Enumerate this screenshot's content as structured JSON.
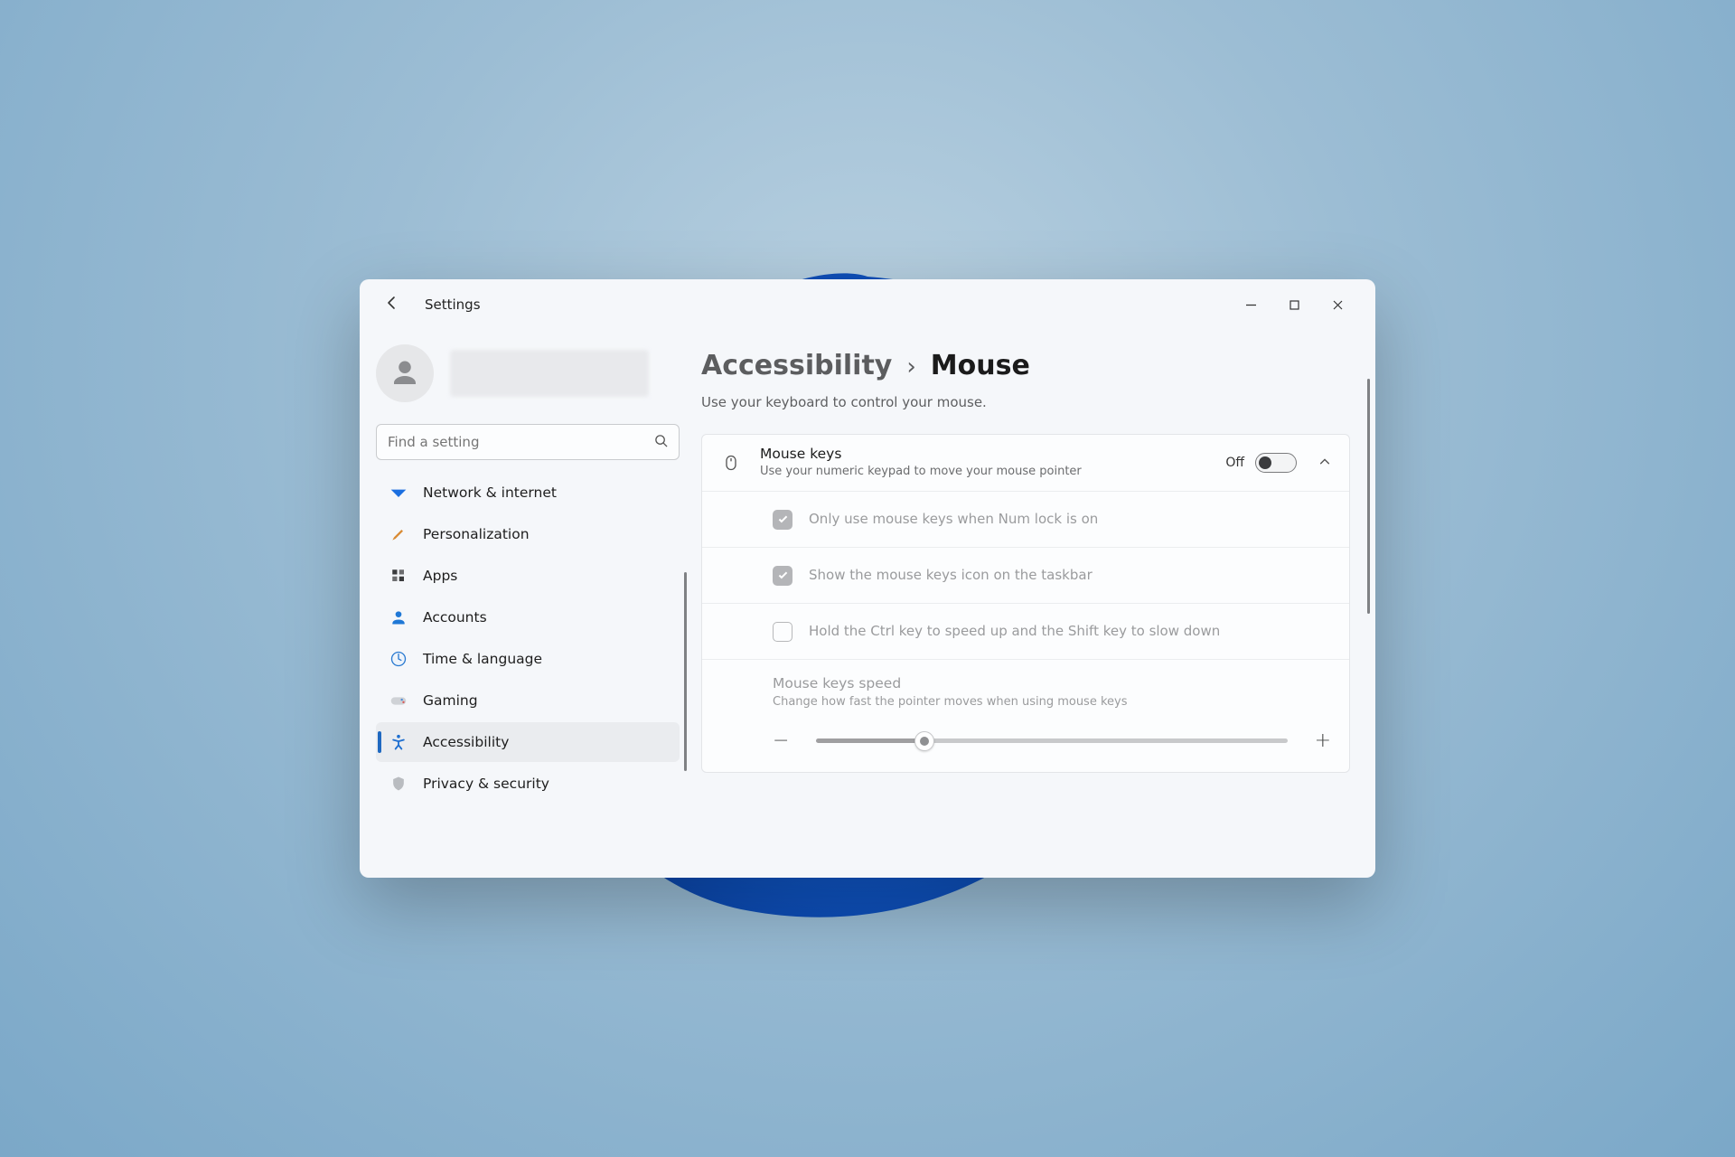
{
  "window": {
    "appTitle": "Settings"
  },
  "search": {
    "placeholder": "Find a setting"
  },
  "sidebar": {
    "items": [
      {
        "label": "Network & internet"
      },
      {
        "label": "Personalization"
      },
      {
        "label": "Apps"
      },
      {
        "label": "Accounts"
      },
      {
        "label": "Time & language"
      },
      {
        "label": "Gaming"
      },
      {
        "label": "Accessibility"
      },
      {
        "label": "Privacy & security"
      }
    ]
  },
  "breadcrumb": {
    "parent": "Accessibility",
    "current": "Mouse"
  },
  "page": {
    "subtitle": "Use your keyboard to control your mouse.",
    "mouseKeys": {
      "title": "Mouse keys",
      "desc": "Use your numeric keypad to move your mouse pointer",
      "toggleLabel": "Off"
    },
    "opts": {
      "numlock": "Only use mouse keys when Num lock is on",
      "taskbarIcon": "Show the mouse keys icon on the taskbar",
      "ctrlShift": "Hold the Ctrl key to speed up and the Shift key to slow down"
    },
    "speed": {
      "title": "Mouse keys speed",
      "desc": "Change how fast the pointer moves when using mouse keys"
    }
  }
}
